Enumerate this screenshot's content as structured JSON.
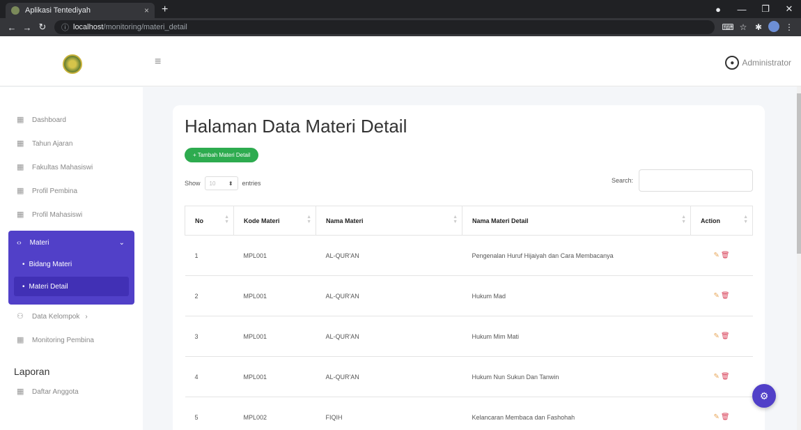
{
  "browser": {
    "tab_title": "Aplikasi Tentediyah",
    "tab_close": "×",
    "new_tab": "+",
    "url_host": "localhost",
    "url_path": "/monitoring/materi_detail"
  },
  "header": {
    "user_name": "Administrator"
  },
  "sidebar": {
    "items": [
      {
        "label": "Dashboard"
      },
      {
        "label": "Tahun Ajaran"
      },
      {
        "label": "Fakultas Mahasiswi"
      },
      {
        "label": "Profil Pembina"
      },
      {
        "label": "Profil Mahasiswi"
      }
    ],
    "active_group": {
      "label": "Materi",
      "subs": [
        {
          "label": "Bidang Materi"
        },
        {
          "label": "Materi Detail"
        }
      ]
    },
    "items_after": [
      {
        "label": "Data Kelompok"
      },
      {
        "label": "Monitoring Pembina"
      }
    ],
    "section_title": "Laporan",
    "report_items": [
      {
        "label": "Daftar Anggota"
      }
    ]
  },
  "main": {
    "title": "Halaman Data Materi Detail",
    "add_button": "+ Tambah Materi Detail",
    "show_label": "Show",
    "show_value": "10",
    "entries_label": "entries",
    "search_label": "Search:",
    "columns": [
      "No",
      "Kode Materi",
      "Nama Materi",
      "Nama Materi Detail",
      "Action"
    ],
    "rows": [
      {
        "no": "1",
        "kode": "MPL001",
        "nama": "AL-QUR'AN",
        "detail": "Pengenalan Huruf Hijaiyah dan Cara Membacanya"
      },
      {
        "no": "2",
        "kode": "MPL001",
        "nama": "AL-QUR'AN",
        "detail": "Hukum Mad"
      },
      {
        "no": "3",
        "kode": "MPL001",
        "nama": "AL-QUR'AN",
        "detail": "Hukum Mim Mati"
      },
      {
        "no": "4",
        "kode": "MPL001",
        "nama": "AL-QUR'AN",
        "detail": "Hukum Nun Sukun Dan Tanwin"
      },
      {
        "no": "5",
        "kode": "MPL002",
        "nama": "FIQIH",
        "detail": "Kelancaran Membaca dan Fashohah"
      }
    ]
  },
  "colors": {
    "accent": "#5140c8",
    "add_button": "#2dab4f"
  }
}
